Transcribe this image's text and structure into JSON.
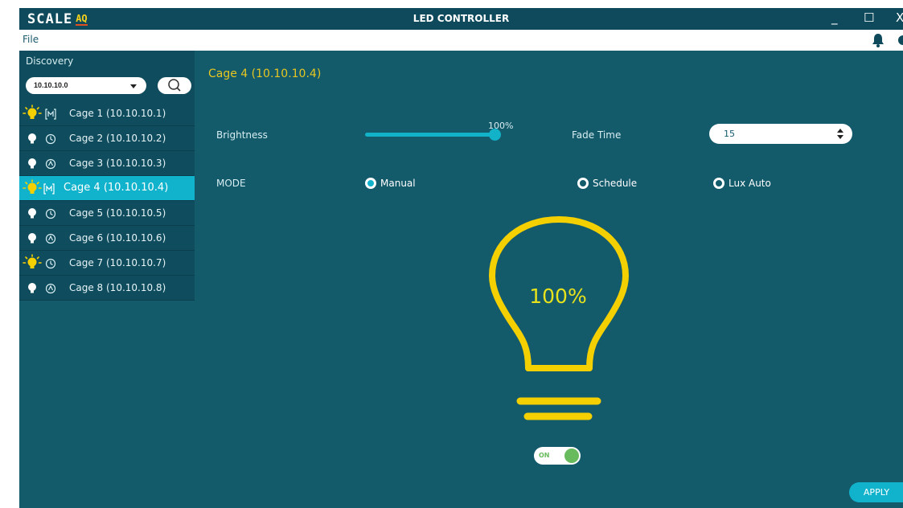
{
  "window": {
    "logo_text": "SCALE",
    "logo_badge": "AQ",
    "title": "LED CONTROLLER",
    "minimize": "_",
    "maximize": "☐",
    "close": "X"
  },
  "menu": {
    "file_label": "File"
  },
  "sidebar": {
    "title": "Discovery",
    "ip_selected": "10.10.10.0",
    "cages": [
      {
        "label": "Cage 1 (10.10.10.1)",
        "light": "bulb-on-icon",
        "mode": "manual-icon",
        "active": false
      },
      {
        "label": "Cage 2 (10.10.10.2)",
        "light": "bulb-off-icon",
        "mode": "schedule-icon",
        "active": false
      },
      {
        "label": "Cage 3 (10.10.10.3)",
        "light": "bulb-off-icon",
        "mode": "lux-auto-icon",
        "active": false
      },
      {
        "label": "Cage 4 (10.10.10.4)",
        "light": "bulb-on-icon",
        "mode": "manual-icon",
        "active": true
      },
      {
        "label": "Cage 5 (10.10.10.5)",
        "light": "bulb-off-icon",
        "mode": "schedule-icon",
        "active": false
      },
      {
        "label": "Cage 6 (10.10.10.6)",
        "light": "bulb-off-icon",
        "mode": "lux-auto-icon",
        "active": false
      },
      {
        "label": "Cage 7 (10.10.10.7)",
        "light": "bulb-on-icon",
        "mode": "schedule-icon",
        "active": false
      },
      {
        "label": "Cage 8 (10.10.10.8)",
        "light": "bulb-off-icon",
        "mode": "lux-auto-icon",
        "active": false
      }
    ]
  },
  "main": {
    "title": "Cage 4 (10.10.10.4)",
    "brightness_label": "Brightness",
    "brightness_value": "100%",
    "fade_label": "Fade Time",
    "fade_value": "15",
    "mode_label": "MODE",
    "modes": [
      "Manual",
      "Schedule",
      "Lux Auto"
    ],
    "selected_mode": "Manual",
    "bulb_percent": "100%",
    "toggle_label": "ON",
    "apply_label": "APPLY"
  },
  "colors": {
    "background": "#135a6b",
    "titlebar": "#0f4a5c",
    "accent": "#11b3cc",
    "bulb": "#f5d000",
    "bulb_text": "#e7e21c",
    "toggle_on": "#67bb5c"
  }
}
